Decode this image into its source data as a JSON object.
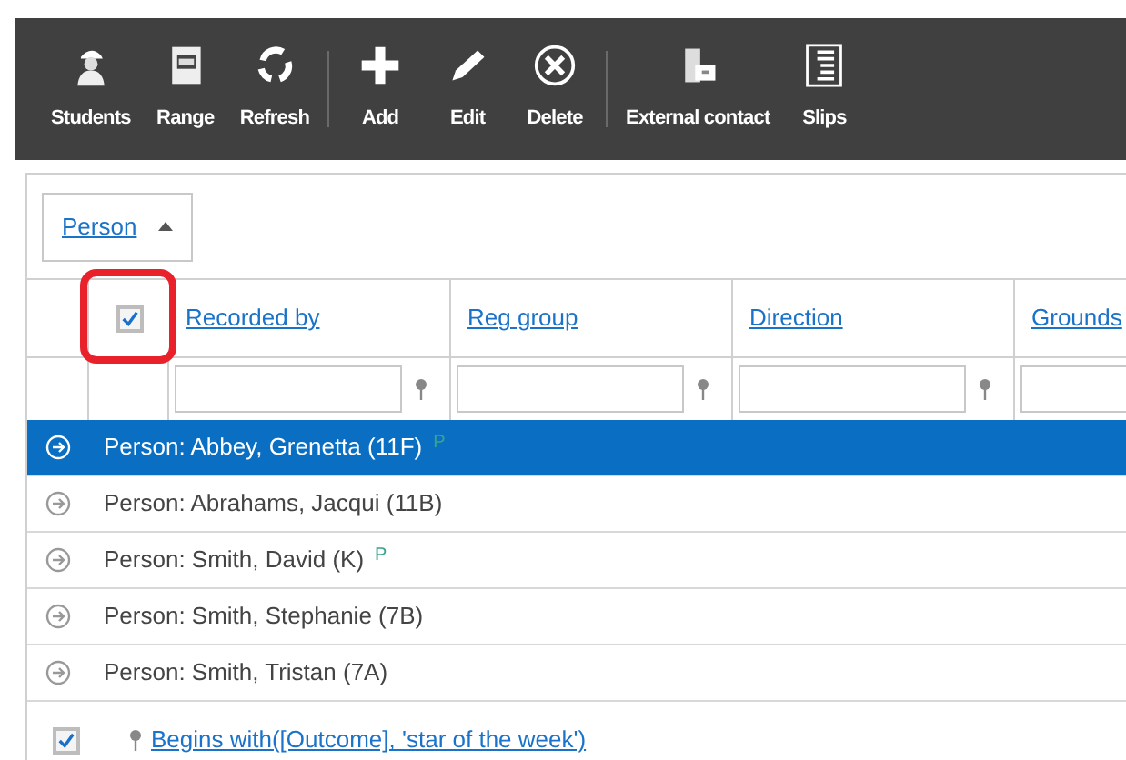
{
  "toolbar": [
    {
      "label": "Students",
      "separator_after": false
    },
    {
      "label": "Range",
      "separator_after": false
    },
    {
      "label": "Refresh",
      "separator_after": true
    },
    {
      "label": "Add",
      "separator_after": false
    },
    {
      "label": "Edit",
      "separator_after": false
    },
    {
      "label": "Delete",
      "separator_after": true
    },
    {
      "label": "External contact",
      "separator_after": false
    },
    {
      "label": "Slips",
      "separator_after": false
    }
  ],
  "group_panel": {
    "label": "Person"
  },
  "header_checkbox": {
    "checked": true,
    "highlighted": true
  },
  "columns": [
    {
      "label": "Recorded by"
    },
    {
      "label": "Reg group"
    },
    {
      "label": "Direction"
    },
    {
      "label": "Grounds"
    }
  ],
  "rows": [
    {
      "text": "Person: Abbey, Grenetta (11F)",
      "marker": "P",
      "selected": true
    },
    {
      "text": "Person: Abrahams, Jacqui (11B)",
      "selected": false
    },
    {
      "text": "Person: Smith, David (K)",
      "marker": "P",
      "selected": false
    },
    {
      "text": "Person: Smith, Stephanie (7B)",
      "selected": false
    },
    {
      "text": "Person: Smith, Tristan (7A)",
      "selected": false
    }
  ],
  "filter": {
    "checked": true,
    "text": "Begins with([Outcome], 'star of the week')"
  }
}
